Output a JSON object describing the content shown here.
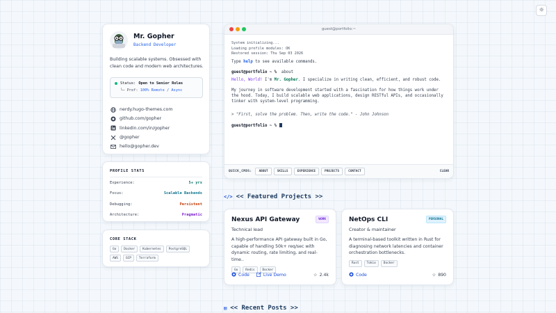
{
  "theme_toggle": {
    "icon": "sun-icon",
    "glyph": "☼"
  },
  "profile": {
    "name": "Mr. Gopher",
    "title": "Backend Developer",
    "bio": "Building scalable systems. Obsessed with clean code and modern web architectures.",
    "status_label": "Status:",
    "status_value": "Open to Senior Roles",
    "pref_label": "└─ Pref:",
    "pref_value": "100% Remote / Async",
    "links": [
      {
        "icon": "globe-icon",
        "text": "nerdy.hugo-themes.com"
      },
      {
        "icon": "github-icon",
        "text": "github.com/gopher"
      },
      {
        "icon": "linkedin-icon",
        "text": "linkedin.com/in/gopher"
      },
      {
        "icon": "x-icon",
        "text": "@gopher"
      },
      {
        "icon": "mail-icon",
        "text": "hello@gopher.dev"
      }
    ]
  },
  "stats": {
    "heading": "PROFILE STATS",
    "rows": [
      {
        "label": "Experience:",
        "value": "5+ yrs",
        "color": "#0f766e"
      },
      {
        "label": "Focus:",
        "value": "Scalable Backends",
        "color": "#0e7490"
      },
      {
        "label": "Debugging:",
        "value": "Persistent",
        "color": "#c2410c"
      },
      {
        "label": "Architecture:",
        "value": "Pragmatic",
        "color": "#7e22ce"
      }
    ]
  },
  "stack": {
    "heading": "CORE STACK",
    "tags": [
      "Go",
      "Docker",
      "Kubernetes",
      "PostgreSQL",
      "AWS",
      "GCP",
      "Terraform"
    ]
  },
  "terminal": {
    "title": "guest@portfolio:~",
    "sys": [
      "System initializing...",
      "Loading profile modules: OK",
      "Restored session: Thu Sep 03 2026"
    ],
    "help_pre": "Type ",
    "help_cmd": "help",
    "help_post": " to see available commands.",
    "prompt": "guest@portfolio ~ %",
    "command": "about",
    "hello": "Hello, World!",
    "im": " I'm ",
    "me": "Mr. Gopher",
    "intro_rest": ". I specialize in writing clean, efficient, and robust code.",
    "journey": "My journey in software development started with a fascination for how things work under the hood. Today, I build scalable web applications, design RESTful APIs, and occasionally tinker with system-level programming.",
    "quote": "> \"First, solve the problem. Then, write the code.\" - John Johnson",
    "quick_label": "QUICK_CMDS:",
    "quick_cmds": [
      "ABOUT",
      "SKILLS",
      "EXPERIENCE",
      "PROJECTS",
      "CONTACT"
    ],
    "clear": "CLEAR"
  },
  "featured_heading": "<< Featured Projects >>",
  "projects": [
    {
      "title": "Nexus API Gateway",
      "role": "Technical lead",
      "badge": "WORK",
      "badge_color": "#6d28d9",
      "badge_bg": "#f3e8ff",
      "desc": "A high-performance API gateway built in Go, capable of handling 50k+ req/sec with dynamic routing, rate limiting, and real-time..",
      "tags": [
        "Go",
        "Redis",
        "Docker"
      ],
      "code": "Code",
      "demo": "Live Demo",
      "stars": "2.4k"
    },
    {
      "title": "NetOps CLI",
      "role": "Creator & maintainer",
      "badge": "PERSONAL",
      "badge_color": "#0e7490",
      "badge_bg": "#e0f2fe",
      "desc": "A terminal-based toolkit written in Rust for diagnosing network latencies and container orchestration bottlenecks.",
      "tags": [
        "Rust",
        "Tokio",
        "Docker"
      ],
      "code": "Code",
      "stars": "890"
    }
  ],
  "recent_heading": "<< Recent Posts >>"
}
